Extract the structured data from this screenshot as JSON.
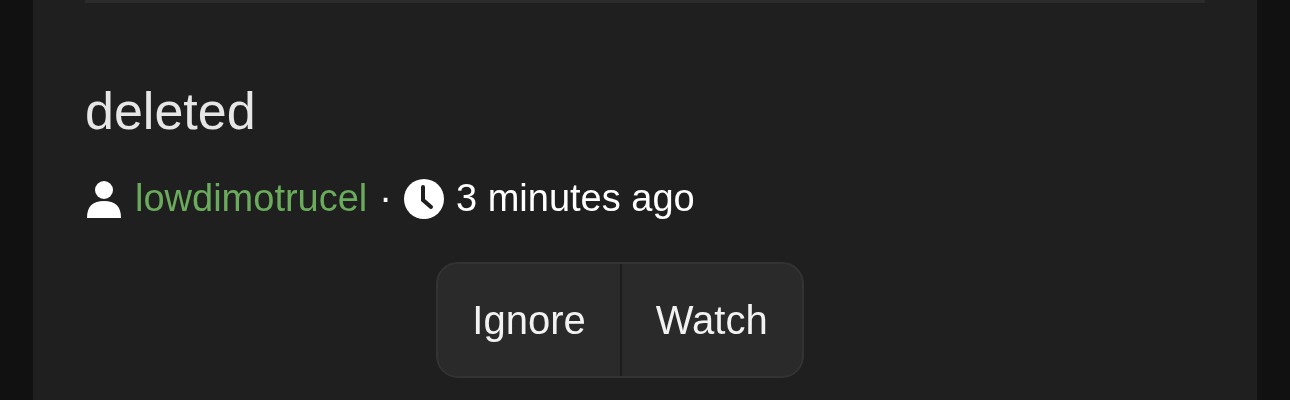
{
  "post": {
    "title": "deleted",
    "author": "lowdimotrucel",
    "separator": "·",
    "time": "3 minutes ago"
  },
  "buttons": [
    {
      "label": "Ignore"
    },
    {
      "label": "Watch"
    }
  ]
}
